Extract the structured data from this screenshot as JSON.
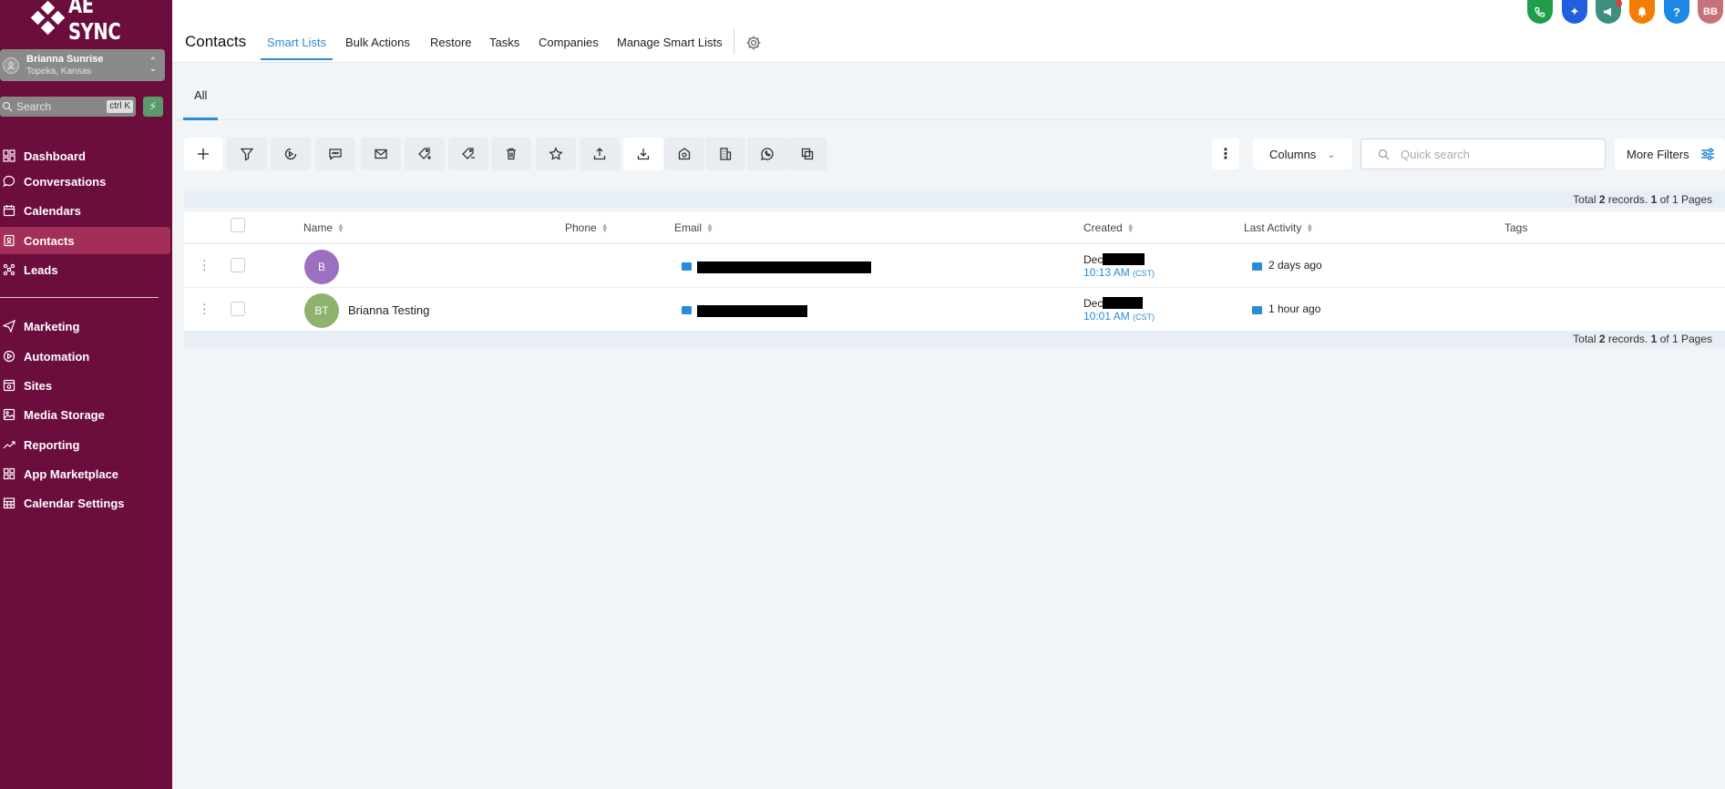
{
  "app": {
    "logo_text": "AE SYNC"
  },
  "account": {
    "name": "Brianna Sunrise",
    "location": "Topeka, Kansas"
  },
  "sidebar_search": {
    "placeholder": "Search",
    "shortcut": "ctrl K"
  },
  "nav": [
    {
      "label": "Dashboard",
      "icon": "dashboard-icon"
    },
    {
      "label": "Conversations",
      "icon": "chat-icon"
    },
    {
      "label": "Calendars",
      "icon": "calendar-icon"
    },
    {
      "label": "Contacts",
      "icon": "contacts-icon",
      "active": true
    },
    {
      "label": "Leads",
      "icon": "leads-icon"
    },
    {
      "label": "Marketing",
      "icon": "send-icon"
    },
    {
      "label": "Automation",
      "icon": "automation-icon"
    },
    {
      "label": "Sites",
      "icon": "sites-icon"
    },
    {
      "label": "Media Storage",
      "icon": "image-icon"
    },
    {
      "label": "Reporting",
      "icon": "trend-icon"
    },
    {
      "label": "App Marketplace",
      "icon": "grid-icon"
    },
    {
      "label": "Calendar Settings",
      "icon": "calendar-grid-icon"
    }
  ],
  "header": {
    "title": "Contacts",
    "tabs": [
      "Smart Lists",
      "Bulk Actions",
      "Restore",
      "Tasks",
      "Companies",
      "Manage Smart Lists"
    ],
    "active_tab": "Smart Lists"
  },
  "top_icons": [
    {
      "name": "phone-icon",
      "color": "#1e9e4a"
    },
    {
      "name": "sparkle-icon",
      "color": "#1f5fe0"
    },
    {
      "name": "megaphone-icon",
      "color": "#3d8f7e"
    },
    {
      "name": "bell-icon",
      "color": "#f57c00"
    },
    {
      "name": "help-icon",
      "color": "#1e88e5",
      "glyph": "?"
    },
    {
      "name": "user-avatar",
      "color": "#c7727a",
      "glyph": "BB"
    }
  ],
  "smart_list_tab": "All",
  "toolbar": {
    "columns_label": "Columns",
    "search_placeholder": "Quick search",
    "more_filters_label": "More Filters"
  },
  "summary": {
    "prefix": "Total",
    "total": "2",
    "mid": "records.",
    "page": "1",
    "suffix": "of 1 Pages"
  },
  "table": {
    "columns": [
      "Name",
      "Phone",
      "Email",
      "Created",
      "Last Activity",
      "Tags"
    ],
    "rows": [
      {
        "initials": "B",
        "avatar_color": "#9c6fc0",
        "name": "",
        "created_date": "Dec",
        "created_time": "10:13 AM",
        "tz": "(CST)",
        "last_activity": "2 days ago"
      },
      {
        "initials": "BT",
        "avatar_color": "#8fb36f",
        "name": "Brianna Testing",
        "created_date": "Dec",
        "created_time": "10:01 AM",
        "tz": "(CST)",
        "last_activity": "1 hour ago"
      }
    ]
  },
  "colors": {
    "sidebar": "#6b0d3d",
    "active_nav": "#a32e57",
    "accent": "#2a8bd8"
  }
}
